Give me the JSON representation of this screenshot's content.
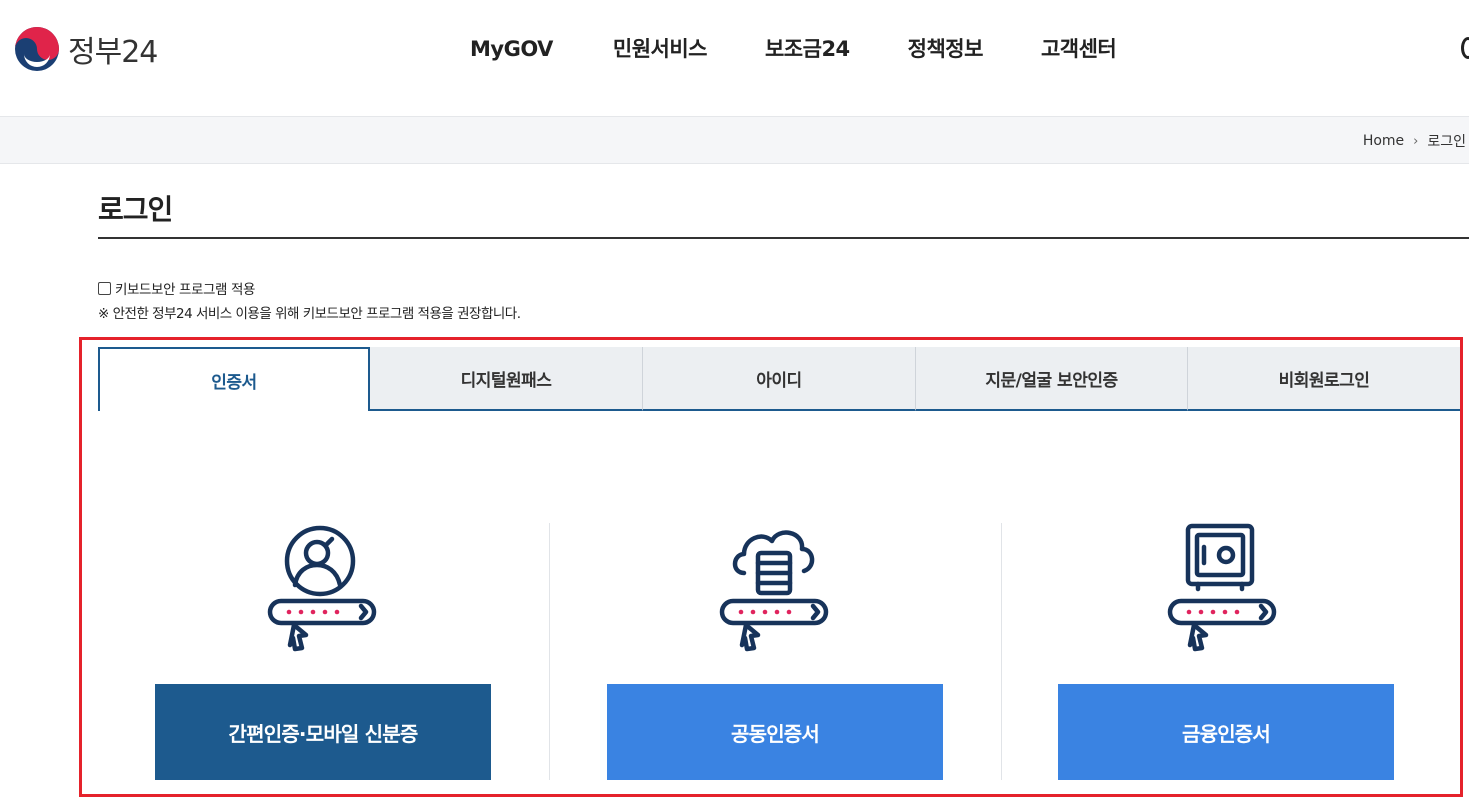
{
  "header": {
    "logo_text": "정부24",
    "nav": [
      "MyGOV",
      "민원서비스",
      "보조금24",
      "정책정보",
      "고객센터"
    ]
  },
  "breadcrumb": {
    "home": "Home",
    "current": "로그인"
  },
  "page": {
    "title": "로그인",
    "keyboard_security_label": "키보드보안 프로그램 적용",
    "keyboard_security_checked": false,
    "notice": "※ 안전한 정부24 서비스 이용을 위해 키보드보안 프로그램 적용을 권장합니다."
  },
  "tabs": [
    {
      "label": "인증서",
      "active": true
    },
    {
      "label": "디지털원패스",
      "active": false
    },
    {
      "label": "아이디",
      "active": false
    },
    {
      "label": "지문/얼굴 보안인증",
      "active": false
    },
    {
      "label": "비회원로그인",
      "active": false
    }
  ],
  "methods": [
    {
      "label": "간편인증·모바일 신분증",
      "icon": "person-login-icon"
    },
    {
      "label": "공동인증서",
      "icon": "cloud-server-login-icon"
    },
    {
      "label": "금융인증서",
      "icon": "safe-login-icon"
    }
  ],
  "colors": {
    "primary_dark": "#1d5a8e",
    "primary_light": "#3a83e2",
    "highlight_red": "#e5222b",
    "icon_navy": "#17335a",
    "icon_dots": "#e0245e"
  }
}
